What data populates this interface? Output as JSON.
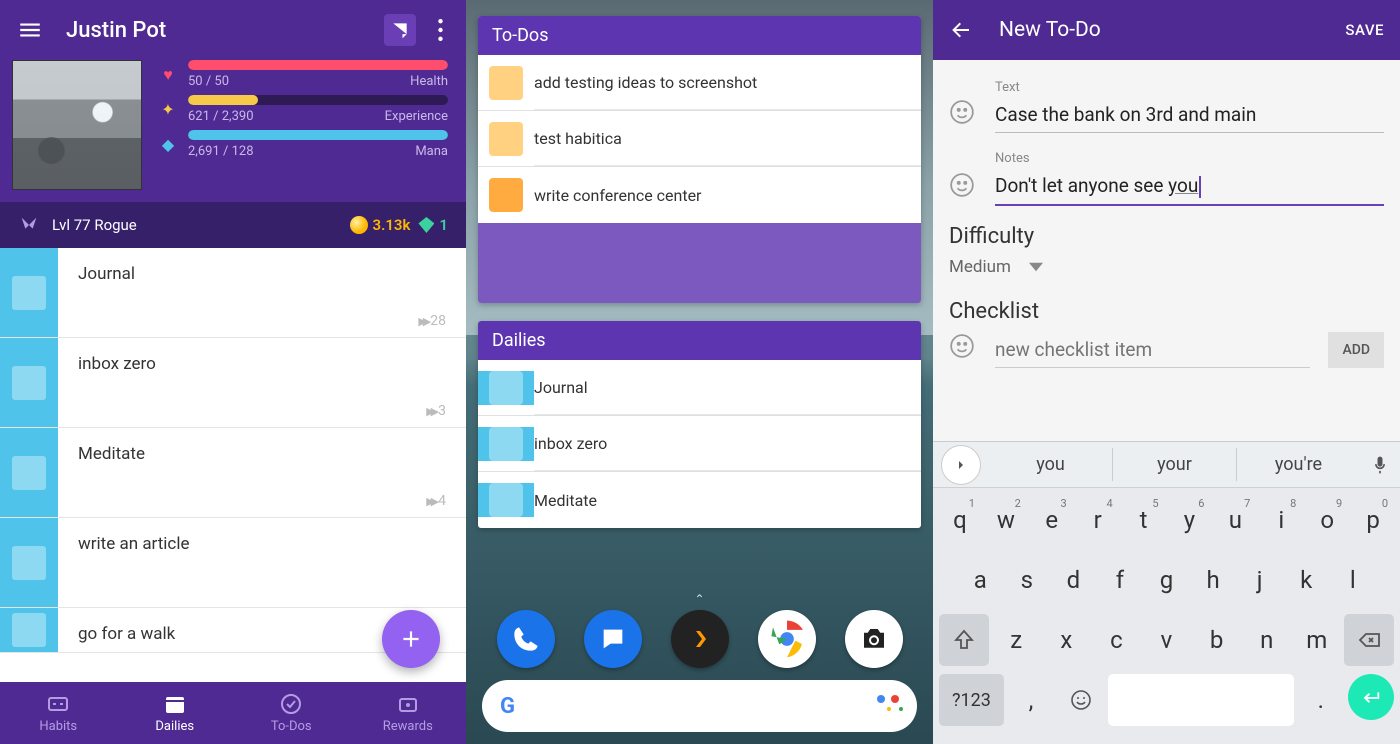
{
  "pane1": {
    "username": "Justin Pot",
    "stats": {
      "health": {
        "value": "50 / 50",
        "label": "Health"
      },
      "xp": {
        "value": "621 / 2,390",
        "label": "Experience"
      },
      "mana": {
        "value": "2,691 / 128",
        "label": "Mana"
      }
    },
    "level_label": "Lvl 77 Rogue",
    "gold": "3.13k",
    "gems": "1",
    "dailies": [
      {
        "title": "Journal",
        "streak": "28"
      },
      {
        "title": "inbox zero",
        "streak": "3"
      },
      {
        "title": "Meditate",
        "streak": "4"
      },
      {
        "title": "write an article",
        "streak": ""
      },
      {
        "title": "go for a walk",
        "streak": ""
      }
    ],
    "tabs": {
      "habits": "Habits",
      "dailies": "Dailies",
      "todos": "To-Dos",
      "rewards": "Rewards"
    }
  },
  "pane2": {
    "todos_header": "To-Dos",
    "todos": [
      "add testing ideas to screenshot",
      "test habitica",
      "write conference center"
    ],
    "dailies_header": "Dailies",
    "dailies": [
      "Journal",
      "inbox zero",
      "Meditate"
    ]
  },
  "pane3": {
    "title": "New To-Do",
    "save": "SAVE",
    "text_label": "Text",
    "text_value": "Case the bank on 3rd and main",
    "notes_label": "Notes",
    "notes_prefix": "Don't let anyone see ",
    "notes_sel": "you",
    "difficulty_header": "Difficulty",
    "difficulty_value": "Medium",
    "checklist_header": "Checklist",
    "checklist_placeholder": "new checklist item",
    "add_label": "ADD",
    "suggestions": [
      "you",
      "your",
      "you're"
    ],
    "row1": [
      "q",
      "w",
      "e",
      "r",
      "t",
      "y",
      "u",
      "i",
      "o",
      "p"
    ],
    "row1sup": [
      "1",
      "2",
      "3",
      "4",
      "5",
      "6",
      "7",
      "8",
      "9",
      "0"
    ],
    "row2": [
      "a",
      "s",
      "d",
      "f",
      "g",
      "h",
      "j",
      "k",
      "l"
    ],
    "row3": [
      "z",
      "x",
      "c",
      "v",
      "b",
      "n",
      "m"
    ],
    "sym_key": "?123",
    "comma": ",",
    "period": "."
  }
}
